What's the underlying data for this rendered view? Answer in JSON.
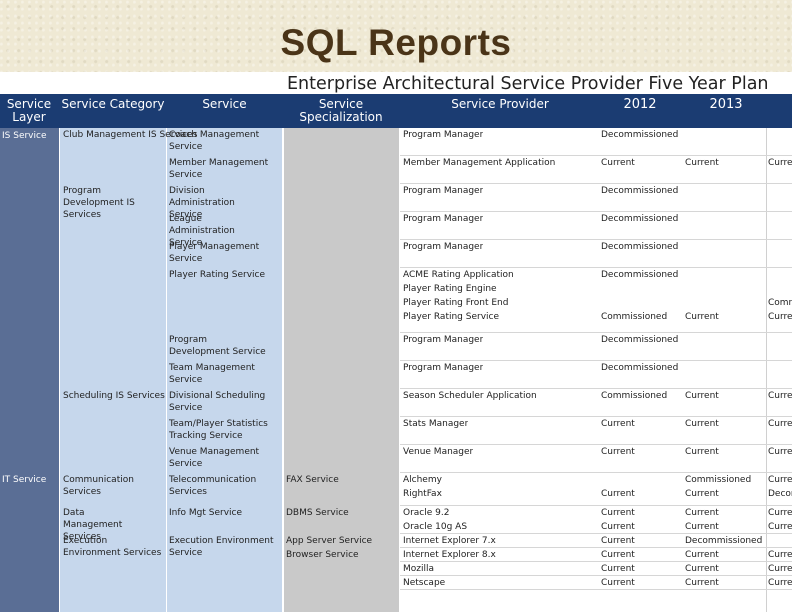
{
  "title": "SQL Reports",
  "subtitle": "Enterprise Architectural Service Provider Five Year Plan",
  "headers": {
    "layer": "Service Layer",
    "category": "Service Category",
    "service": "Service",
    "specialization": "Service Specialization",
    "provider": "Service Provider",
    "y2012": "2012",
    "y2013": "2013"
  },
  "layers": [
    "IS Service",
    "IT Service"
  ],
  "categories": [
    "Club Management IS Services",
    "Program Development IS Services",
    "Scheduling IS Services",
    "Communication Services",
    "Data Management Services",
    "Execution Environment Services"
  ],
  "services": [
    "Coach Management Service",
    "Member Management Service",
    "Division Administration Service",
    "League Administration Service",
    "Player Management Service",
    "Player Rating Service",
    "Program Development Service",
    "Team Management Service",
    "Divisional Scheduling Service",
    "Team/Player Statistics Tracking Service",
    "Venue Management Service",
    "Telecommunication Services",
    "Info Mgt Service",
    "Execution Environment Service"
  ],
  "specializations": [
    "FAX Service",
    "DBMS Service",
    "App Server Service",
    "Browser Service"
  ],
  "rows": [
    {
      "provider": "Program Manager",
      "y2012": "Decommissioned",
      "y2013": "",
      "next": ""
    },
    {
      "provider": "Member Management Application",
      "y2012": "Current",
      "y2013": "Current",
      "next": "Curre"
    },
    {
      "provider": "Program Manager",
      "y2012": "Decommissioned",
      "y2013": "",
      "next": ""
    },
    {
      "provider": "Program Manager",
      "y2012": "Decommissioned",
      "y2013": "",
      "next": ""
    },
    {
      "provider": "Program Manager",
      "y2012": "Decommissioned",
      "y2013": "",
      "next": ""
    },
    {
      "provider": "ACME Rating Application",
      "y2012": "Decommissioned",
      "y2013": "",
      "next": ""
    },
    {
      "provider": "Player Rating Engine",
      "y2012": "",
      "y2013": "",
      "next": ""
    },
    {
      "provider": "Player Rating Front End",
      "y2012": "",
      "y2013": "",
      "next": "Comr"
    },
    {
      "provider": "Player Rating Service",
      "y2012": "Commissioned",
      "y2013": "Current",
      "next": "Curre"
    },
    {
      "provider": "Program Manager",
      "y2012": "Decommissioned",
      "y2013": "",
      "next": ""
    },
    {
      "provider": "Program Manager",
      "y2012": "Decommissioned",
      "y2013": "",
      "next": ""
    },
    {
      "provider": "Season Scheduler Application",
      "y2012": "Commissioned",
      "y2013": "Current",
      "next": "Curre"
    },
    {
      "provider": "Stats Manager",
      "y2012": "Current",
      "y2013": "Current",
      "next": "Curre"
    },
    {
      "provider": "Venue Manager",
      "y2012": "Current",
      "y2013": "Current",
      "next": "Curre"
    },
    {
      "provider": "Alchemy",
      "y2012": "",
      "y2013": "Commissioned",
      "next": "Curre"
    },
    {
      "provider": "RightFax",
      "y2012": "Current",
      "y2013": "Current",
      "next": "Decor"
    },
    {
      "provider": "Oracle 9.2",
      "y2012": "Current",
      "y2013": "Current",
      "next": "Curre"
    },
    {
      "provider": "Oracle 10g AS",
      "y2012": "Current",
      "y2013": "Current",
      "next": "Curre"
    },
    {
      "provider": "Internet Explorer 7.x",
      "y2012": "Current",
      "y2013": "Decommissioned",
      "next": ""
    },
    {
      "provider": "Internet Explorer 8.x",
      "y2012": "Current",
      "y2013": "Current",
      "next": "Curre"
    },
    {
      "provider": "Mozilla",
      "y2012": "Current",
      "y2013": "Current",
      "next": "Curre"
    },
    {
      "provider": "Netscape",
      "y2012": "Current",
      "y2013": "Current",
      "next": "Curre"
    }
  ]
}
